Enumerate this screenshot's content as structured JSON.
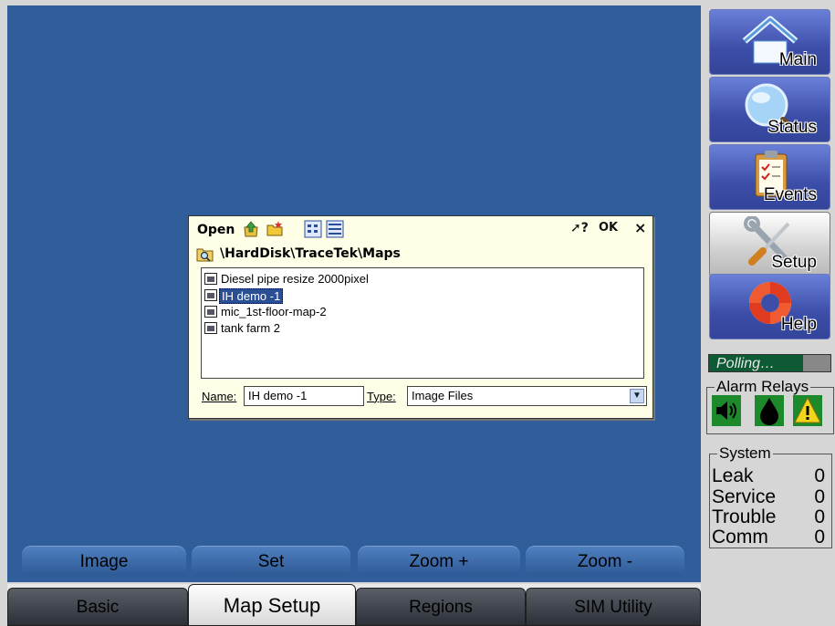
{
  "dialog": {
    "title": "Open",
    "help_label": "?",
    "ok_label": "OK",
    "close_label": "×",
    "path": "\\HardDisk\\TraceTek\\Maps",
    "files": [
      {
        "label": "Diesel pipe resize 2000pixel",
        "selected": false
      },
      {
        "label": "IH demo -1",
        "selected": true
      },
      {
        "label": "mic_1st-floor-map-2",
        "selected": false
      },
      {
        "label": "tank farm 2",
        "selected": false
      }
    ],
    "name_label": "Name:",
    "name_value": "IH demo -1",
    "type_label": "Type:",
    "type_value": "Image Files"
  },
  "commands": [
    "Image",
    "Set",
    "Zoom +",
    "Zoom -"
  ],
  "tabs": [
    {
      "label": "Basic",
      "active": false
    },
    {
      "label": "Map Setup",
      "active": true
    },
    {
      "label": "Regions",
      "active": false
    },
    {
      "label": "SIM Utility",
      "active": false
    }
  ],
  "nav": [
    {
      "label": "Main",
      "icon": "home-icon",
      "active": false
    },
    {
      "label": "Status",
      "icon": "magnifier-icon",
      "active": false
    },
    {
      "label": "Events",
      "icon": "clipboard-icon",
      "active": false
    },
    {
      "label": "Setup",
      "icon": "tools-icon",
      "active": true
    },
    {
      "label": "Help",
      "icon": "lifebuoy-icon",
      "active": false
    }
  ],
  "polling": "Polling…",
  "alarm_relays": {
    "title": "Alarm Relays",
    "relays": [
      "speaker-icon",
      "drop-icon",
      "warning-icon"
    ],
    "colors": {
      "active": "#1c8a2a",
      "warning": "#f2d41a"
    }
  },
  "system": {
    "title": "System",
    "rows": [
      {
        "label": "Leak",
        "value": "0"
      },
      {
        "label": "Service",
        "value": "0"
      },
      {
        "label": "Trouble",
        "value": "0"
      },
      {
        "label": "Comm",
        "value": "0"
      }
    ]
  },
  "colors": {
    "workarea": "#2f5e9a",
    "dialog_bg": "#ffffe8",
    "selection": "#2b4f95"
  }
}
